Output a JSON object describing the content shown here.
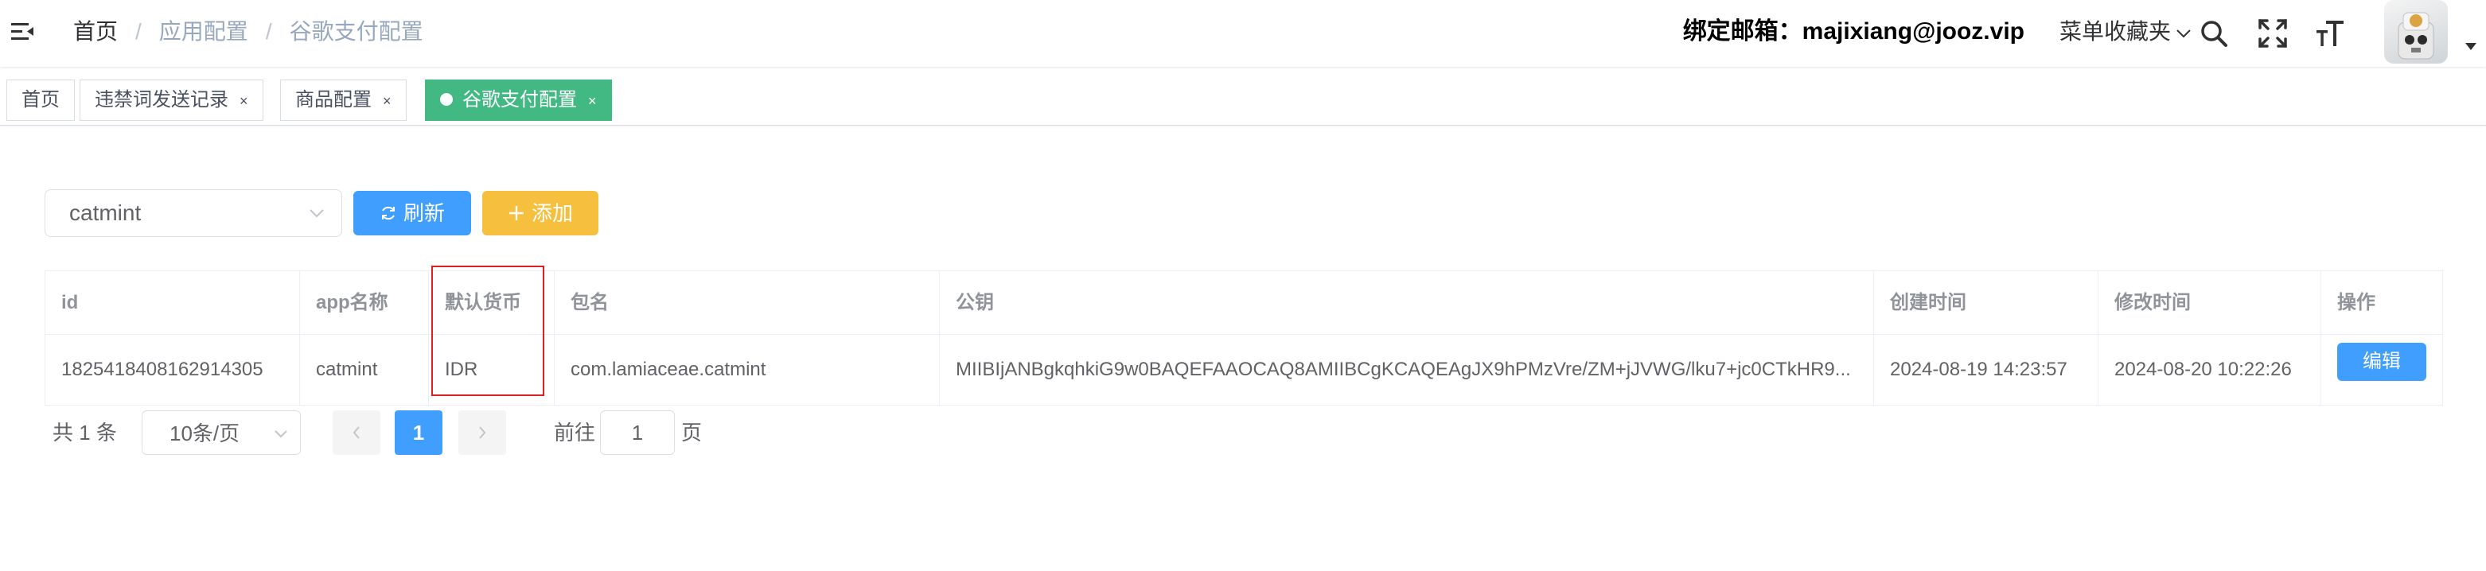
{
  "header": {
    "breadcrumb": [
      "首页",
      "应用配置",
      "谷歌支付配置"
    ],
    "breadcrumb_separator": "/",
    "bind_email": "绑定邮箱：majixiang@jooz.vip",
    "favorites_menu": "菜单收藏夹",
    "icons": [
      "hamburger-icon",
      "search-icon",
      "fullscreen-icon",
      "font-size-icon",
      "avatar",
      "caret-down-icon"
    ]
  },
  "tags": [
    {
      "label": "首页",
      "closable": false,
      "active": false
    },
    {
      "label": "违禁词发送记录",
      "closable": true,
      "active": false
    },
    {
      "label": "商品配置",
      "closable": true,
      "active": false
    },
    {
      "label": "谷歌支付配置",
      "closable": true,
      "active": true
    }
  ],
  "tag_close": "×",
  "toolbar": {
    "app_select_value": "catmint",
    "refresh_label": "刷新",
    "add_label": "添加"
  },
  "table": {
    "columns": [
      "id",
      "app名称",
      "默认货币",
      "包名",
      "公钥",
      "创建时间",
      "修改时间",
      "操作"
    ],
    "rows": [
      {
        "id": "1825418408162914305",
        "app_name": "catmint",
        "currency": "IDR",
        "package": "com.lamiaceae.catmint",
        "public_key": "MIIBIjANBgkqhkiG9w0BAQEFAAOCAQ8AMIIBCgKCAQEAgJX9hPMzVre/ZM+jJVWG/lku7+jc0CTkHR9...",
        "created": "2024-08-19 14:23:57",
        "modified": "2024-08-20 10:22:26",
        "action": "编辑"
      }
    ]
  },
  "pagination": {
    "total": "共 1 条",
    "page_size": "10条/页",
    "current_page": "1",
    "goto_label": "前往",
    "goto_value": "1",
    "page_unit": "页"
  },
  "colors": {
    "primary": "#409eff",
    "warning": "#f7bf3e",
    "active_tag": "#42b983",
    "highlight_box": "#e02020"
  }
}
